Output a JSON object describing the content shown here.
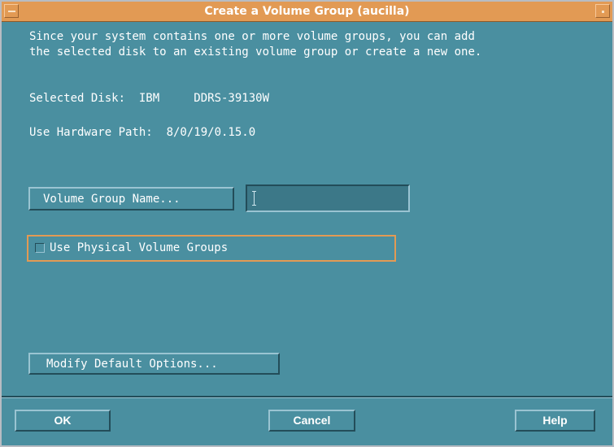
{
  "window": {
    "title": "Create a Volume Group (aucilla)"
  },
  "message": {
    "line1": "Since your system contains one or more volume groups, you can add",
    "line2": "the selected disk to an existing volume group or create a new one."
  },
  "info": {
    "selected_disk": "Selected Disk:  IBM     DDRS-39130W",
    "hardware_path": "Use Hardware Path:  8/0/19/0.15.0"
  },
  "volume_group": {
    "button_label": "Volume Group Name...",
    "field_value": ""
  },
  "physical_volume_groups": {
    "label": "Use Physical Volume Groups",
    "checked": false
  },
  "modify_defaults": {
    "label": "Modify Default Options..."
  },
  "footer": {
    "ok_label": "OK",
    "cancel_label": "Cancel",
    "help_label": "Help"
  },
  "colors": {
    "background": "#4a8fa0",
    "titlebar": "#e29a54",
    "focus_border": "#e29a54",
    "text": "#ffffff"
  }
}
